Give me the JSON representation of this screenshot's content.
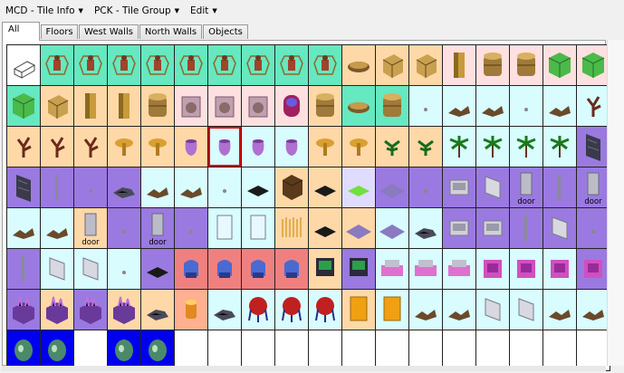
{
  "menu": [
    {
      "label": "MCD - Tile Info"
    },
    {
      "label": "PCK - Tile Group"
    },
    {
      "label": "Edit"
    }
  ],
  "tabs": [
    {
      "label": "All",
      "active": true
    },
    {
      "label": "Floors",
      "active": false
    },
    {
      "label": "West Walls",
      "active": false
    },
    {
      "label": "North Walls",
      "active": false
    },
    {
      "label": "Objects",
      "active": false
    }
  ],
  "palette": {
    "aqua": "#66e8c0",
    "peach": "#ffd8a8",
    "pink": "#ffe0e0",
    "cyan": "#d8fcff",
    "violet": "#9a7ae0",
    "lilac": "#e0dcff",
    "rose": "#f08080",
    "salmon": "#ffb090",
    "blue": "#0000ee",
    "white": "#ffffff",
    "gray": "#f4f4f4"
  },
  "rows": [
    [
      {
        "bg": "white",
        "icon": "box-wire"
      },
      {
        "bg": "aqua",
        "icon": "figure"
      },
      {
        "bg": "aqua",
        "icon": "figure"
      },
      {
        "bg": "aqua",
        "icon": "figure"
      },
      {
        "bg": "aqua",
        "icon": "figure"
      },
      {
        "bg": "aqua",
        "icon": "figure"
      },
      {
        "bg": "aqua",
        "icon": "figure"
      },
      {
        "bg": "aqua",
        "icon": "figure"
      },
      {
        "bg": "aqua",
        "icon": "figure"
      },
      {
        "bg": "aqua",
        "icon": "figure"
      },
      {
        "bg": "peach",
        "icon": "bowl"
      },
      {
        "bg": "peach",
        "icon": "crate"
      },
      {
        "bg": "peach",
        "icon": "crate"
      },
      {
        "bg": "pink",
        "icon": "pillar"
      },
      {
        "bg": "pink",
        "icon": "barrel"
      },
      {
        "bg": "pink",
        "icon": "barrel"
      },
      {
        "bg": "pink",
        "icon": "green-block"
      },
      {
        "bg": "pink",
        "icon": "green-block"
      }
    ],
    [
      {
        "bg": "aqua",
        "icon": "green-block"
      },
      {
        "bg": "peach",
        "icon": "crate"
      },
      {
        "bg": "peach",
        "icon": "pillar"
      },
      {
        "bg": "peach",
        "icon": "pillar"
      },
      {
        "bg": "peach",
        "icon": "barrel"
      },
      {
        "bg": "pink",
        "icon": "glass-box"
      },
      {
        "bg": "pink",
        "icon": "glass-box"
      },
      {
        "bg": "pink",
        "icon": "glass-box"
      },
      {
        "bg": "pink",
        "icon": "pod"
      },
      {
        "bg": "peach",
        "icon": "barrel"
      },
      {
        "bg": "aqua",
        "icon": "bowl"
      },
      {
        "bg": "aqua",
        "icon": "barrel"
      },
      {
        "bg": "cyan",
        "icon": "tiny"
      },
      {
        "bg": "cyan",
        "icon": "debris"
      },
      {
        "bg": "cyan",
        "icon": "debris"
      },
      {
        "bg": "cyan",
        "icon": "tiny"
      },
      {
        "bg": "cyan",
        "icon": "debris"
      },
      {
        "bg": "cyan",
        "icon": "coral"
      }
    ],
    [
      {
        "bg": "peach",
        "icon": "coral"
      },
      {
        "bg": "peach",
        "icon": "coral"
      },
      {
        "bg": "peach",
        "icon": "coral"
      },
      {
        "bg": "peach",
        "icon": "mushroom"
      },
      {
        "bg": "peach",
        "icon": "mushroom"
      },
      {
        "bg": "peach",
        "icon": "vase"
      },
      {
        "bg": "cyan",
        "icon": "vase",
        "selected": true
      },
      {
        "bg": "cyan",
        "icon": "vase"
      },
      {
        "bg": "cyan",
        "icon": "vase"
      },
      {
        "bg": "peach",
        "icon": "mushroom"
      },
      {
        "bg": "peach",
        "icon": "mushroom"
      },
      {
        "bg": "peach",
        "icon": "plant"
      },
      {
        "bg": "peach",
        "icon": "plant"
      },
      {
        "bg": "cyan",
        "icon": "palm"
      },
      {
        "bg": "cyan",
        "icon": "palm"
      },
      {
        "bg": "cyan",
        "icon": "palm"
      },
      {
        "bg": "cyan",
        "icon": "palm"
      },
      {
        "bg": "violet",
        "icon": "rock-wall"
      }
    ],
    [
      {
        "bg": "violet",
        "icon": "rock-wall"
      },
      {
        "bg": "violet",
        "icon": "pole"
      },
      {
        "bg": "violet",
        "icon": "tiny"
      },
      {
        "bg": "violet",
        "icon": "rubble"
      },
      {
        "bg": "cyan",
        "icon": "debris"
      },
      {
        "bg": "cyan",
        "icon": "debris"
      },
      {
        "bg": "cyan",
        "icon": "tiny"
      },
      {
        "bg": "cyan",
        "icon": "dark-tile"
      },
      {
        "bg": "peach",
        "icon": "brown-block"
      },
      {
        "bg": "peach",
        "icon": "dark-tile"
      },
      {
        "bg": "lilac",
        "icon": "green-tile"
      },
      {
        "bg": "violet",
        "icon": "floor"
      },
      {
        "bg": "violet",
        "icon": "tiny"
      },
      {
        "bg": "violet",
        "icon": "terminal"
      },
      {
        "bg": "violet",
        "icon": "frame"
      },
      {
        "bg": "violet",
        "icon": "door",
        "label": "door"
      },
      {
        "bg": "violet",
        "icon": "pole"
      },
      {
        "bg": "violet",
        "icon": "door",
        "label": "door"
      }
    ],
    [
      {
        "bg": "cyan",
        "icon": "debris"
      },
      {
        "bg": "cyan",
        "icon": "debris"
      },
      {
        "bg": "peach",
        "icon": "door",
        "label": "door"
      },
      {
        "bg": "violet",
        "icon": "tiny"
      },
      {
        "bg": "violet",
        "icon": "door",
        "label": "door"
      },
      {
        "bg": "violet",
        "icon": "tiny"
      },
      {
        "bg": "cyan",
        "icon": "glass-frame"
      },
      {
        "bg": "cyan",
        "icon": "glass-frame"
      },
      {
        "bg": "peach",
        "icon": "spikes"
      },
      {
        "bg": "peach",
        "icon": "dark-tile"
      },
      {
        "bg": "peach",
        "icon": "floor"
      },
      {
        "bg": "cyan",
        "icon": "floor"
      },
      {
        "bg": "cyan",
        "icon": "rubble"
      },
      {
        "bg": "violet",
        "icon": "terminal"
      },
      {
        "bg": "violet",
        "icon": "terminal"
      },
      {
        "bg": "violet",
        "icon": "pole"
      },
      {
        "bg": "violet",
        "icon": "frame"
      },
      {
        "bg": "violet",
        "icon": "tiny"
      }
    ],
    [
      {
        "bg": "violet",
        "icon": "pole"
      },
      {
        "bg": "cyan",
        "icon": "frame"
      },
      {
        "bg": "cyan",
        "icon": "frame"
      },
      {
        "bg": "cyan",
        "icon": "tiny"
      },
      {
        "bg": "violet",
        "icon": "dark-tile"
      },
      {
        "bg": "rose",
        "icon": "seat"
      },
      {
        "bg": "rose",
        "icon": "seat"
      },
      {
        "bg": "rose",
        "icon": "seat"
      },
      {
        "bg": "rose",
        "icon": "seat"
      },
      {
        "bg": "peach",
        "icon": "monitor"
      },
      {
        "bg": "violet",
        "icon": "monitor"
      },
      {
        "bg": "cyan",
        "icon": "console"
      },
      {
        "bg": "cyan",
        "icon": "console"
      },
      {
        "bg": "cyan",
        "icon": "console"
      },
      {
        "bg": "cyan",
        "icon": "machine"
      },
      {
        "bg": "cyan",
        "icon": "machine"
      },
      {
        "bg": "cyan",
        "icon": "machine"
      },
      {
        "bg": "violet",
        "icon": "machine"
      }
    ],
    [
      {
        "bg": "violet",
        "icon": "crystal"
      },
      {
        "bg": "peach",
        "icon": "crystal"
      },
      {
        "bg": "violet",
        "icon": "crystal"
      },
      {
        "bg": "peach",
        "icon": "crystal"
      },
      {
        "bg": "peach",
        "icon": "rubble"
      },
      {
        "bg": "salmon",
        "icon": "lamp"
      },
      {
        "bg": "cyan",
        "icon": "rubble"
      },
      {
        "bg": "cyan",
        "icon": "sphere"
      },
      {
        "bg": "cyan",
        "icon": "sphere"
      },
      {
        "bg": "cyan",
        "icon": "sphere"
      },
      {
        "bg": "peach",
        "icon": "gold-panel"
      },
      {
        "bg": "cyan",
        "icon": "gold-panel"
      },
      {
        "bg": "cyan",
        "icon": "debris"
      },
      {
        "bg": "cyan",
        "icon": "debris"
      },
      {
        "bg": "cyan",
        "icon": "frame"
      },
      {
        "bg": "cyan",
        "icon": "frame"
      },
      {
        "bg": "cyan",
        "icon": "debris"
      },
      {
        "bg": "cyan",
        "icon": "debris"
      }
    ],
    [
      {
        "bg": "blue",
        "icon": "alien"
      },
      {
        "bg": "blue",
        "icon": "alien"
      },
      {
        "bg": "white",
        "icon": "none"
      },
      {
        "bg": "blue",
        "icon": "alien"
      },
      {
        "bg": "blue",
        "icon": "alien"
      },
      {
        "bg": "white",
        "icon": "none"
      },
      {
        "bg": "white",
        "icon": "none"
      },
      {
        "bg": "white",
        "icon": "none"
      },
      {
        "bg": "white",
        "icon": "none"
      },
      {
        "bg": "white",
        "icon": "none"
      },
      {
        "bg": "white",
        "icon": "none"
      },
      {
        "bg": "white",
        "icon": "none"
      },
      {
        "bg": "white",
        "icon": "none"
      },
      {
        "bg": "white",
        "icon": "none"
      },
      {
        "bg": "white",
        "icon": "none"
      },
      {
        "bg": "white",
        "icon": "none"
      },
      {
        "bg": "white",
        "icon": "none"
      },
      {
        "bg": "white",
        "icon": "none"
      }
    ]
  ]
}
